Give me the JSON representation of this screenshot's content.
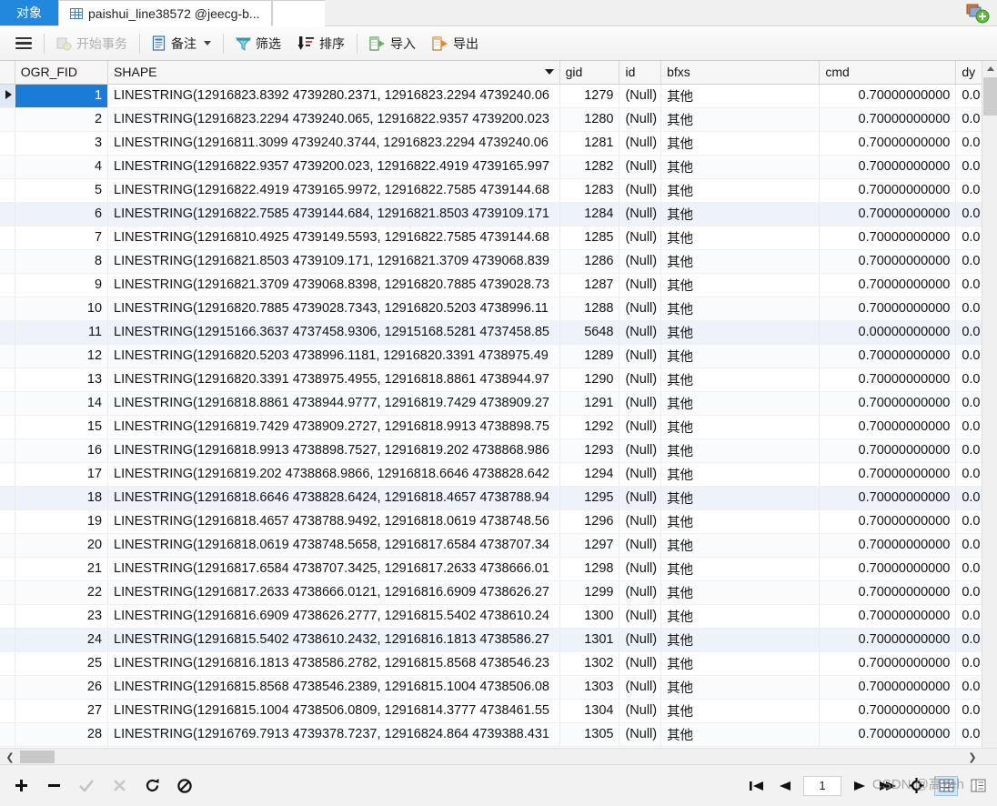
{
  "tabs": {
    "object_tab": "对象",
    "table_tab": "paishui_line38572 @jeecg-b...",
    "table_tab_icon": "grid-icon",
    "new_tab_icon": "new-tab-icon"
  },
  "toolbar": {
    "menu_icon": "hamburger-menu-icon",
    "begin_transaction": "开始事务",
    "begin_transaction_icon": "transaction-icon",
    "note": "备注",
    "note_icon": "note-icon",
    "note_caret": "chevron-down-icon",
    "filter": "筛选",
    "filter_icon": "funnel-icon",
    "sort": "排序",
    "sort_icon": "sort-descending-icon",
    "import": "导入",
    "import_icon": "import-icon",
    "export": "导出",
    "export_icon": "export-icon"
  },
  "grid": {
    "columns": [
      "OGR_FID",
      "SHAPE",
      "gid",
      "id",
      "bfxs",
      "cmd",
      "dy"
    ],
    "sort_caret_column": "SHAPE",
    "null_label": "(Null)",
    "rows": [
      {
        "n": "1",
        "shape": "LINESTRING(12916823.8392 4739280.2371, 12916823.2294 4739240.06",
        "gid": "1279",
        "id": "(Null)",
        "bfxs": "其他",
        "cmd": "0.70000000000",
        "dy": "0.0"
      },
      {
        "n": "2",
        "shape": "LINESTRING(12916823.2294 4739240.065, 12916822.9357 4739200.023",
        "gid": "1280",
        "id": "(Null)",
        "bfxs": "其他",
        "cmd": "0.70000000000",
        "dy": "0.0"
      },
      {
        "n": "3",
        "shape": "LINESTRING(12916811.3099 4739240.3744, 12916823.2294 4739240.06",
        "gid": "1281",
        "id": "(Null)",
        "bfxs": "其他",
        "cmd": "0.70000000000",
        "dy": "0.0"
      },
      {
        "n": "4",
        "shape": "LINESTRING(12916822.9357 4739200.023, 12916822.4919 4739165.997",
        "gid": "1282",
        "id": "(Null)",
        "bfxs": "其他",
        "cmd": "0.70000000000",
        "dy": "0.0"
      },
      {
        "n": "5",
        "shape": "LINESTRING(12916822.4919 4739165.9972, 12916822.7585 4739144.68",
        "gid": "1283",
        "id": "(Null)",
        "bfxs": "其他",
        "cmd": "0.70000000000",
        "dy": "0.0"
      },
      {
        "n": "6",
        "shape": "LINESTRING(12916822.7585 4739144.684, 12916821.8503 4739109.171",
        "gid": "1284",
        "id": "(Null)",
        "bfxs": "其他",
        "cmd": "0.70000000000",
        "dy": "0.0"
      },
      {
        "n": "7",
        "shape": "LINESTRING(12916810.4925 4739149.5593, 12916822.7585 4739144.68",
        "gid": "1285",
        "id": "(Null)",
        "bfxs": "其他",
        "cmd": "0.70000000000",
        "dy": "0.0"
      },
      {
        "n": "8",
        "shape": "LINESTRING(12916821.8503 4739109.171, 12916821.3709 4739068.839",
        "gid": "1286",
        "id": "(Null)",
        "bfxs": "其他",
        "cmd": "0.70000000000",
        "dy": "0.0"
      },
      {
        "n": "9",
        "shape": "LINESTRING(12916821.3709 4739068.8398, 12916820.7885 4739028.73",
        "gid": "1287",
        "id": "(Null)",
        "bfxs": "其他",
        "cmd": "0.70000000000",
        "dy": "0.0"
      },
      {
        "n": "10",
        "shape": "LINESTRING(12916820.7885 4739028.7343, 12916820.5203 4738996.11",
        "gid": "1288",
        "id": "(Null)",
        "bfxs": "其他",
        "cmd": "0.70000000000",
        "dy": "0.0"
      },
      {
        "n": "11",
        "shape": "LINESTRING(12915166.3637 4737458.9306, 12915168.5281 4737458.85",
        "gid": "5648",
        "id": "(Null)",
        "bfxs": "其他",
        "cmd": "0.00000000000",
        "dy": "0.0"
      },
      {
        "n": "12",
        "shape": "LINESTRING(12916820.5203 4738996.1181, 12916820.3391 4738975.49",
        "gid": "1289",
        "id": "(Null)",
        "bfxs": "其他",
        "cmd": "0.70000000000",
        "dy": "0.0"
      },
      {
        "n": "13",
        "shape": "LINESTRING(12916820.3391 4738975.4955, 12916818.8861 4738944.97",
        "gid": "1290",
        "id": "(Null)",
        "bfxs": "其他",
        "cmd": "0.70000000000",
        "dy": "0.0"
      },
      {
        "n": "14",
        "shape": "LINESTRING(12916818.8861 4738944.9777, 12916819.7429 4738909.27",
        "gid": "1291",
        "id": "(Null)",
        "bfxs": "其他",
        "cmd": "0.70000000000",
        "dy": "0.0"
      },
      {
        "n": "15",
        "shape": "LINESTRING(12916819.7429 4738909.2727, 12916818.9913 4738898.75",
        "gid": "1292",
        "id": "(Null)",
        "bfxs": "其他",
        "cmd": "0.70000000000",
        "dy": "0.0"
      },
      {
        "n": "16",
        "shape": "LINESTRING(12916818.9913 4738898.7527, 12916819.202 4738868.986",
        "gid": "1293",
        "id": "(Null)",
        "bfxs": "其他",
        "cmd": "0.70000000000",
        "dy": "0.0"
      },
      {
        "n": "17",
        "shape": "LINESTRING(12916819.202 4738868.9866, 12916818.6646 4738828.642",
        "gid": "1294",
        "id": "(Null)",
        "bfxs": "其他",
        "cmd": "0.70000000000",
        "dy": "0.0"
      },
      {
        "n": "18",
        "shape": "LINESTRING(12916818.6646 4738828.6424, 12916818.4657 4738788.94",
        "gid": "1295",
        "id": "(Null)",
        "bfxs": "其他",
        "cmd": "0.70000000000",
        "dy": "0.0"
      },
      {
        "n": "19",
        "shape": "LINESTRING(12916818.4657 4738788.9492, 12916818.0619 4738748.56",
        "gid": "1296",
        "id": "(Null)",
        "bfxs": "其他",
        "cmd": "0.70000000000",
        "dy": "0.0"
      },
      {
        "n": "20",
        "shape": "LINESTRING(12916818.0619 4738748.5658, 12916817.6584 4738707.34",
        "gid": "1297",
        "id": "(Null)",
        "bfxs": "其他",
        "cmd": "0.70000000000",
        "dy": "0.0"
      },
      {
        "n": "21",
        "shape": "LINESTRING(12916817.6584 4738707.3425, 12916817.2633 4738666.01",
        "gid": "1298",
        "id": "(Null)",
        "bfxs": "其他",
        "cmd": "0.70000000000",
        "dy": "0.0"
      },
      {
        "n": "22",
        "shape": "LINESTRING(12916817.2633 4738666.0121, 12916816.6909 4738626.27",
        "gid": "1299",
        "id": "(Null)",
        "bfxs": "其他",
        "cmd": "0.70000000000",
        "dy": "0.0"
      },
      {
        "n": "23",
        "shape": "LINESTRING(12916816.6909 4738626.2777, 12916815.5402 4738610.24",
        "gid": "1300",
        "id": "(Null)",
        "bfxs": "其他",
        "cmd": "0.70000000000",
        "dy": "0.0"
      },
      {
        "n": "24",
        "shape": "LINESTRING(12916815.5402 4738610.2432, 12916816.1813 4738586.27",
        "gid": "1301",
        "id": "(Null)",
        "bfxs": "其他",
        "cmd": "0.70000000000",
        "dy": "0.0"
      },
      {
        "n": "25",
        "shape": "LINESTRING(12916816.1813 4738586.2782, 12916815.8568 4738546.23",
        "gid": "1302",
        "id": "(Null)",
        "bfxs": "其他",
        "cmd": "0.70000000000",
        "dy": "0.0"
      },
      {
        "n": "26",
        "shape": "LINESTRING(12916815.8568 4738546.2389, 12916815.1004 4738506.08",
        "gid": "1303",
        "id": "(Null)",
        "bfxs": "其他",
        "cmd": "0.70000000000",
        "dy": "0.0"
      },
      {
        "n": "27",
        "shape": "LINESTRING(12916815.1004 4738506.0809, 12916814.3777 4738461.55",
        "gid": "1304",
        "id": "(Null)",
        "bfxs": "其他",
        "cmd": "0.70000000000",
        "dy": "0.0"
      },
      {
        "n": "28",
        "shape": "LINESTRING(12916769.7913 4739378.7237, 12916824.864 4739388.431",
        "gid": "1305",
        "id": "(Null)",
        "bfxs": "其他",
        "cmd": "0.70000000000",
        "dy": "0.0"
      }
    ]
  },
  "statusbar": {
    "add_record": "+",
    "delete_record": "−",
    "apply_icon": "check-icon",
    "cancel_icon": "cross-icon",
    "refresh_icon": "refresh-icon",
    "stop_icon": "stop-icon",
    "first_icon": "first-page-icon",
    "prev_icon": "previous-page-icon",
    "page_value": "1",
    "next_icon": "next-page-icon",
    "last_icon": "last-page-icon",
    "settings_icon": "gear-icon",
    "grid_view_icon": "grid-view-icon",
    "form_view_icon": "form-view-icon",
    "watermark": "CSDN @高zeh",
    "h_scroll_left_icon": "chevron-left-icon",
    "h_scroll_right_icon": "chevron-right-icon"
  },
  "colors": {
    "accent": "#2288dd",
    "selection": "#1a7cd6",
    "row_alt": "#fafbfc",
    "header_bg": "#f6f6f6"
  }
}
